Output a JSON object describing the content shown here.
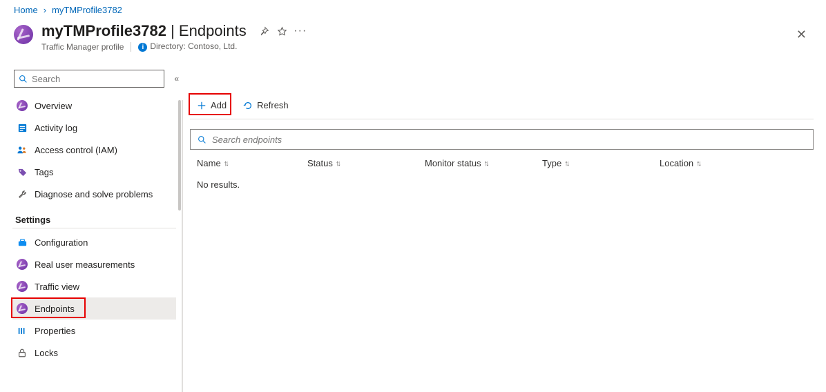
{
  "breadcrumb": {
    "home": "Home",
    "current": "myTMProfile3782"
  },
  "header": {
    "resource_name": "myTMProfile3782",
    "section": "Endpoints",
    "subtitle": "Traffic Manager profile",
    "directory_label": "Directory: Contoso, Ltd."
  },
  "sidebar": {
    "search_placeholder": "Search",
    "section_settings": "Settings",
    "items": {
      "overview": "Overview",
      "activity_log": "Activity log",
      "access_control": "Access control (IAM)",
      "tags": "Tags",
      "diagnose": "Diagnose and solve problems",
      "configuration": "Configuration",
      "rum": "Real user measurements",
      "traffic_view": "Traffic view",
      "endpoints": "Endpoints",
      "properties": "Properties",
      "locks": "Locks"
    }
  },
  "toolbar": {
    "add": "Add",
    "refresh": "Refresh"
  },
  "endpoints": {
    "search_placeholder": "Search endpoints",
    "columns": {
      "name": "Name",
      "status": "Status",
      "monitor": "Monitor status",
      "type": "Type",
      "location": "Location"
    },
    "no_results": "No results."
  }
}
